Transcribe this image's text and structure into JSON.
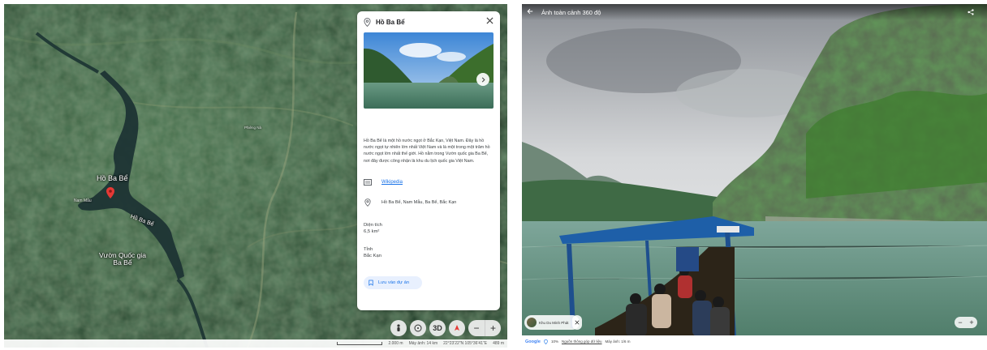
{
  "earth": {
    "labels": {
      "lake": "Hồ Ba Bể",
      "lake_dup": "Hồ Ba Bể",
      "park": "Vườn Quốc gia Ba Bể",
      "nam_mau": "Nam Mẫu",
      "ridge": "Phiêng Nà"
    },
    "controls": {
      "pegman_icon": "person-icon",
      "compass_icon": "compass-icon",
      "view_3d": "3D",
      "north_icon": "north-arrow-icon",
      "zoom_out": "−",
      "zoom_in": "+"
    },
    "footer": {
      "scale": "2.000 m",
      "camera": "Máy ảnh: 14 km",
      "coords": "22°23'22\"N 105°36'41\"E",
      "altitude": "489 m"
    }
  },
  "panel": {
    "title": "Hồ Ba Bể",
    "description": "Hồ Ba Bể là một hồ nước ngọt ở Bắc Kạn, Việt Nam. Đây là hồ nước ngọt tự nhiên lớn nhất Việt Nam và là một trong một trăm hồ nước ngọt lớn nhất thế giới. Hồ nằm trong Vườn quốc gia Ba Bể, nơi đây được công nhận là khu du lịch quốc gia Việt Nam.",
    "wiki_link": "Wikipedia",
    "address": "Hồ Ba Bể, Nam Mẫu, Ba Bể, Bắc Kạn",
    "area_label": "Diện tích",
    "area_value": "6,5 km²",
    "province_label": "Tỉnh",
    "province_value": "Bắc Kạn",
    "save_label": "Lưu vào dự án"
  },
  "streetview": {
    "title": "Ảnh toàn cảnh 360 độ",
    "chip_label": "Khu Du Minh Phát",
    "footer_logo": "Google",
    "footer_zoom": "10%",
    "footer_link": "Nguồn thông góp dữ liệu",
    "footer_extra": "Máy ảnh: 1/6 m",
    "zoom_out": "−",
    "zoom_in": "+"
  },
  "colors": {
    "link": "#1a73e8",
    "pin": "#e53935",
    "save_bg": "#e8f0fe"
  }
}
